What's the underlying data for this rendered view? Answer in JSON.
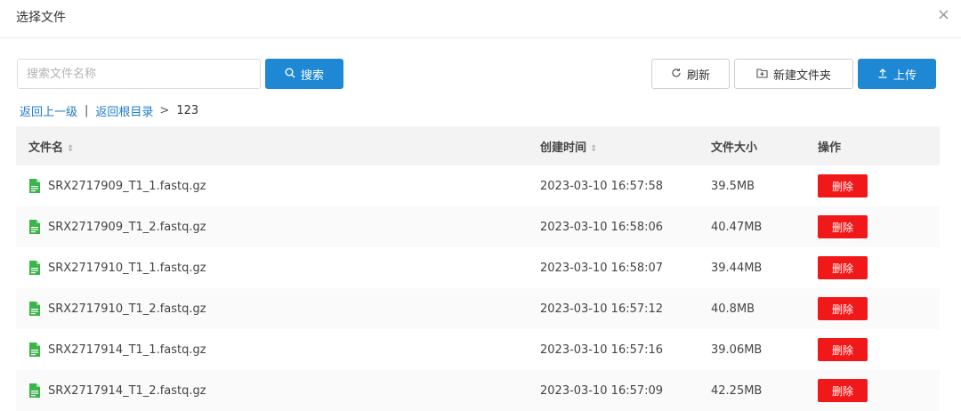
{
  "dialog": {
    "title": "选择文件",
    "close_symbol": "×"
  },
  "search": {
    "placeholder": "搜索文件名称",
    "value": "",
    "button_label": "搜索"
  },
  "toolbar": {
    "refresh_label": "刷新",
    "new_folder_label": "新建文件夹",
    "upload_label": "上传"
  },
  "breadcrumb": {
    "up_one_level": "返回上一级",
    "separator": "|",
    "root": "返回根目录",
    "arrow": ">",
    "current": "123"
  },
  "table": {
    "headers": {
      "name": "文件名",
      "created": "创建时间",
      "size": "文件大小",
      "actions": "操作"
    },
    "delete_label": "删除",
    "rows": [
      {
        "name": "SRX2717909_T1_1.fastq.gz",
        "created": "2023-03-10 16:57:58",
        "size": "39.5MB"
      },
      {
        "name": "SRX2717909_T1_2.fastq.gz",
        "created": "2023-03-10 16:58:06",
        "size": "40.47MB"
      },
      {
        "name": "SRX2717910_T1_1.fastq.gz",
        "created": "2023-03-10 16:58:07",
        "size": "39.44MB"
      },
      {
        "name": "SRX2717910_T1_2.fastq.gz",
        "created": "2023-03-10 16:57:12",
        "size": "40.8MB"
      },
      {
        "name": "SRX2717914_T1_1.fastq.gz",
        "created": "2023-03-10 16:57:16",
        "size": "39.06MB"
      },
      {
        "name": "SRX2717914_T1_2.fastq.gz",
        "created": "2023-03-10 16:57:09",
        "size": "42.25MB"
      }
    ]
  },
  "colors": {
    "primary": "#1e88d4",
    "link": "#1e7cc8",
    "danger": "#f01818",
    "file_icon": "#3bb44a"
  },
  "icons": {
    "search": "search-icon",
    "refresh": "refresh-icon",
    "new_folder": "new-folder-icon",
    "upload": "upload-icon",
    "file": "file-icon",
    "sort": "sort-icon",
    "close": "close-icon"
  }
}
